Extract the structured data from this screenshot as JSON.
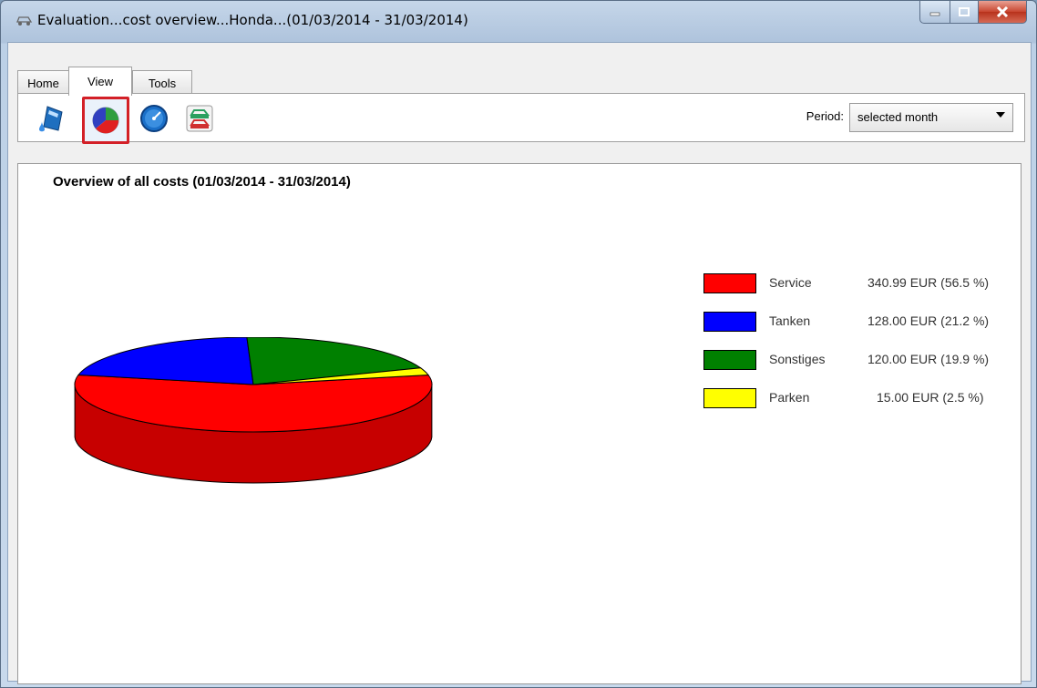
{
  "window": {
    "title": "Evaluation...cost overview...Honda...(01/03/2014 - 31/03/2014)"
  },
  "tabs": [
    {
      "label": "Home",
      "active": false
    },
    {
      "label": "View",
      "active": true
    },
    {
      "label": "Tools",
      "active": false
    }
  ],
  "toolbar": {
    "buttons": [
      {
        "icon": "fuel-icon",
        "selected": false
      },
      {
        "icon": "pie-chart-icon",
        "selected": true
      },
      {
        "icon": "speedometer-icon",
        "selected": false
      },
      {
        "icon": "cars-icon",
        "selected": false
      }
    ],
    "period_label": "Period:",
    "period_value": "selected month"
  },
  "chart_data": {
    "type": "pie",
    "title": "Overview of all costs (01/03/2014 - 31/03/2014)",
    "slices": [
      {
        "label": "Service",
        "value": 340.99,
        "value_text": "340.99 EUR (56.5 %)",
        "color": "#ff0000"
      },
      {
        "label": "Tanken",
        "value": 128.0,
        "value_text": "128.00 EUR (21.2 %)",
        "color": "#0000ff"
      },
      {
        "label": "Sonstiges",
        "value": 120.0,
        "value_text": "120.00 EUR (19.9 %)",
        "color": "#008000"
      },
      {
        "label": "Parken",
        "value": 15.0,
        "value_text": "15.00 EUR (2.5 %)",
        "color": "#ffff00"
      }
    ],
    "legend_position": "right"
  },
  "colors": {
    "selection_border": "#d32027"
  }
}
